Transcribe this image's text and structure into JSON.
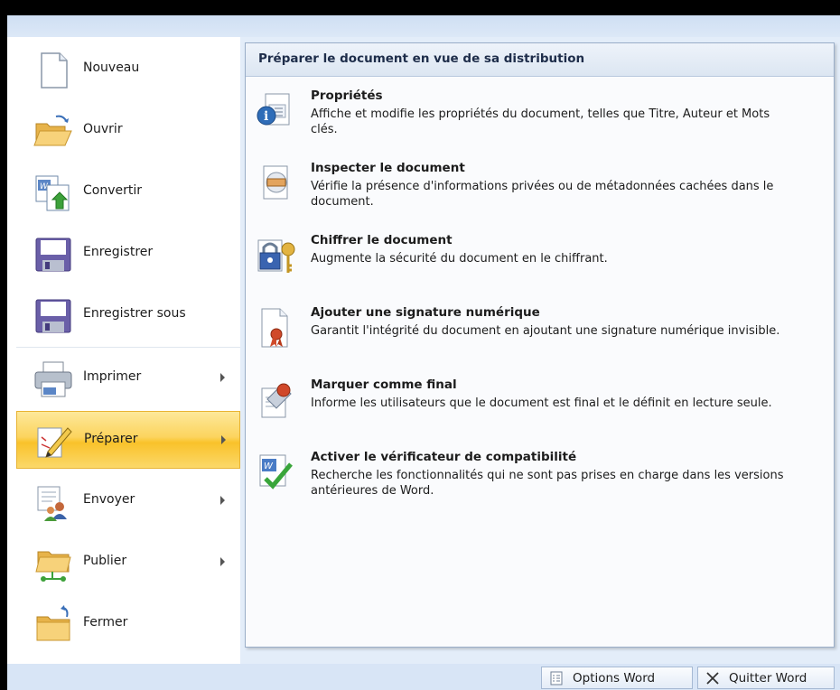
{
  "left_menu": {
    "items": [
      {
        "id": "nouveau",
        "label": "Nouveau",
        "icon": "new-document-icon"
      },
      {
        "id": "ouvrir",
        "label": "Ouvrir",
        "icon": "open-folder-icon"
      },
      {
        "id": "convertir",
        "label": "Convertir",
        "icon": "convert-document-icon"
      },
      {
        "id": "enregistrer",
        "label": "Enregistrer",
        "icon": "save-disk-icon"
      },
      {
        "id": "enregistrer-sous",
        "label": "Enregistrer sous",
        "icon": "save-as-disk-icon"
      },
      {
        "id": "imprimer",
        "label": "Imprimer",
        "icon": "printer-icon"
      },
      {
        "id": "preparer",
        "label": "Préparer",
        "icon": "prepare-pencil-icon"
      },
      {
        "id": "envoyer",
        "label": "Envoyer",
        "icon": "send-people-icon"
      },
      {
        "id": "publier",
        "label": "Publier",
        "icon": "publish-folder-icon"
      },
      {
        "id": "fermer",
        "label": "Fermer",
        "icon": "close-folder-icon"
      }
    ]
  },
  "panel": {
    "title": "Préparer le document en vue de sa distribution",
    "options": [
      {
        "title": "Propriétés",
        "description": "Affiche et modifie les propriétés du document, telles que Titre, Auteur et Mots clés.",
        "icon": "properties-icon"
      },
      {
        "title": "Inspecter le document",
        "description": "Vérifie la présence d'informations privées ou de métadonnées cachées dans le document.",
        "icon": "inspect-document-icon"
      },
      {
        "title": "Chiffrer le document",
        "description": "Augmente la sécurité du document en le chiffrant.",
        "icon": "encrypt-lock-icon"
      },
      {
        "title": "Ajouter une signature numérique",
        "description": "Garantit l'intégrité du document en ajoutant une signature numérique invisible.",
        "icon": "digital-signature-icon"
      },
      {
        "title": "Marquer comme final",
        "description": "Informe les utilisateurs que le document est final et le définit en lecture seule.",
        "icon": "mark-final-icon"
      },
      {
        "title": "Activer le vérificateur de compatibilité",
        "description": "Recherche les fonctionnalités qui ne sont pas prises en charge dans les versions antérieures de Word.",
        "icon": "compatibility-checker-icon"
      }
    ]
  },
  "footer": {
    "options_label": "Options Word",
    "quit_label": "Quitter Word"
  },
  "colors": {
    "active_item": "#fcd45e",
    "panel_border": "#9aaec8",
    "background": "#e3edf9"
  }
}
